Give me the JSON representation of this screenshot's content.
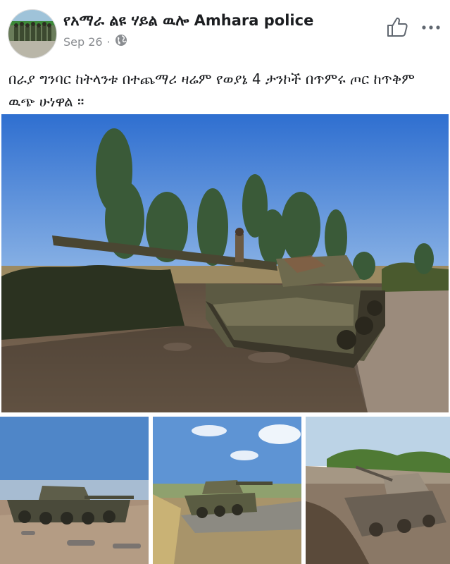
{
  "post": {
    "page_name": "የአማራ ልዩ ሃይል ዉሎ Amhara police",
    "date": "Sep 26",
    "separator": "·",
    "privacy_icon": "globe-icon",
    "caption": "በራያ ግንባር ከትላንቱ በተጨማሪ ዛሬም የወያኔ 4 ታንኮች በጥምሩ ጦር ከጥቅም ዉጭ ሁነዋል ።"
  },
  "icons": {
    "like": "thumbs-up-icon",
    "more": "more-dots-icon"
  },
  "photos": [
    {
      "name": "main-photo",
      "subject": "tank on roadside"
    },
    {
      "name": "thumb-photo-1",
      "subject": "tank in field"
    },
    {
      "name": "thumb-photo-2",
      "subject": "tank on road"
    },
    {
      "name": "thumb-photo-3",
      "subject": "destroyed tank"
    }
  ],
  "colors": {
    "sky": "#3a7fd4",
    "ground": "#7a6450",
    "tank": "#5a5a40",
    "text": "#1c1e21",
    "meta": "#8a8d91"
  }
}
